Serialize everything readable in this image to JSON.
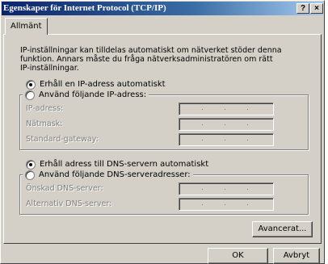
{
  "window": {
    "title": "Egenskaper för Internet Protocol (TCP/IP)",
    "help_label": "?",
    "close_label": "×"
  },
  "tabs": [
    {
      "label": "Allmänt",
      "selected": true
    }
  ],
  "intro_lines": [
    "IP-inställningar kan tilldelas automatiskt om nätverket stöder denna",
    "funktion. Annars måste du fråga nätverksadministratören om rätt",
    "IP-inställningar."
  ],
  "ip": {
    "auto_label": "Erhåll en IP-adress automatiskt",
    "auto_selected": true,
    "manual_label": "Använd följande IP-adress:",
    "manual_selected": false,
    "fields": [
      {
        "label": "IP-adress:",
        "value": "",
        "disabled": true
      },
      {
        "label": "Nätmask:",
        "value": "",
        "disabled": true
      },
      {
        "label": "Standard-gateway:",
        "value": "",
        "disabled": true
      }
    ]
  },
  "dns": {
    "auto_label": "Erhåll adress till DNS-servern automatiskt",
    "auto_selected": true,
    "manual_label": "Använd följande DNS-serveradresser:",
    "manual_selected": false,
    "fields": [
      {
        "label": "Önskad DNS-server:",
        "value": "",
        "disabled": true
      },
      {
        "label": "Alternativ DNS-server:",
        "value": "",
        "disabled": true
      }
    ]
  },
  "buttons": {
    "advanced": "Avancerat...",
    "ok": "OK",
    "cancel": "Avbryt"
  }
}
